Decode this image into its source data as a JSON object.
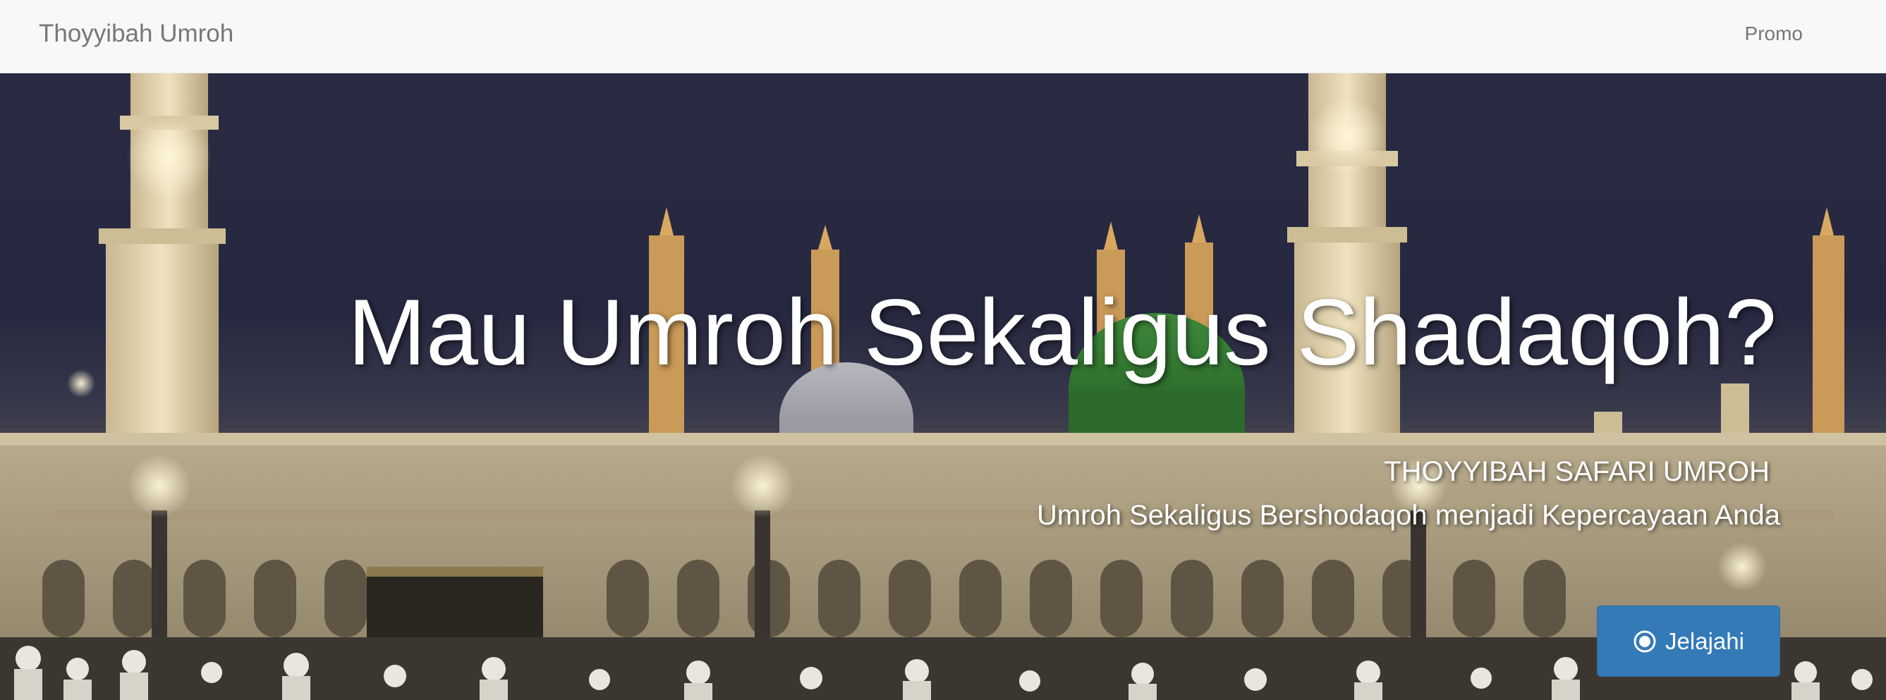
{
  "navbar": {
    "brand": "Thoyyibah Umroh",
    "links": [
      {
        "label": "Promo"
      }
    ]
  },
  "hero": {
    "title": "Mau Umroh Sekaligus Shadaqoh?",
    "subtitle_1": "THOYYIBAH SAFARI UMROH",
    "subtitle_2": "Umroh Sekaligus Bershodaqoh menjadi Kepercayaan Anda",
    "cta": {
      "label": "Jelajahi",
      "icon": "record-circle-icon"
    },
    "background_image": "illuminated-mosque-night-photo"
  },
  "colors": {
    "navbar_bg": "#f8f8f8",
    "nav_text": "#777777",
    "primary_button": "#337ab7",
    "hero_text": "#ffffff"
  }
}
